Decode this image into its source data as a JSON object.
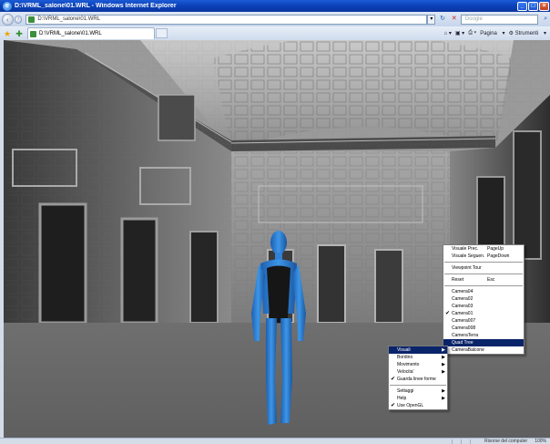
{
  "window": {
    "title": "D:\\VRML_salone\\01.WRL - Windows Internet Explorer",
    "min_glyph": "_",
    "max_glyph": "□",
    "close_glyph": "×"
  },
  "address_bar": {
    "url": "D:\\VRML_salone\\01.WRL",
    "search_placeholder": "Google"
  },
  "tab": {
    "title": "D:\\VRML_salone\\01.WRL"
  },
  "command_bar": {
    "pagina": "Pagina",
    "strumenti": "Strumenti"
  },
  "context_menu": {
    "items": [
      {
        "label": "Visuali",
        "selected": true,
        "submenu": true
      },
      {
        "label": "Bordino",
        "submenu": true
      },
      {
        "label": "Movimento",
        "submenu": true
      },
      {
        "label": "Velocita'",
        "submenu": true
      },
      {
        "label": "Guarda linee forme",
        "checked": true
      },
      {
        "label": "Settaggi",
        "submenu": true
      },
      {
        "label": "Help",
        "submenu": true
      },
      {
        "label": "Use OpenGL",
        "checked": true
      }
    ]
  },
  "viewpoint_menu": {
    "items": [
      {
        "label": "Visuale Prec.",
        "shortcut": "PageUp"
      },
      {
        "label": "Visuale Seguen.",
        "shortcut": "PageDown"
      },
      {
        "label": "Viewpoint Tour"
      },
      {
        "label": "Reset",
        "shortcut": "Esc"
      },
      {
        "label": "Camera04"
      },
      {
        "label": "Camera02"
      },
      {
        "label": "Camera03"
      },
      {
        "label": "Camera01",
        "checked": true
      },
      {
        "label": "Camera007"
      },
      {
        "label": "Camera008"
      },
      {
        "label": "CameraTerra"
      },
      {
        "label": "Quad Tree",
        "selected": true
      },
      {
        "label": "CameraBalcone"
      }
    ]
  },
  "status_bar": {
    "zone": "Risorse del computer",
    "zoom": "100%"
  },
  "colors": {
    "title_bar": "#0a3fb5",
    "menu_highlight": "#0a246a",
    "avatar": "#2b7cd1"
  }
}
